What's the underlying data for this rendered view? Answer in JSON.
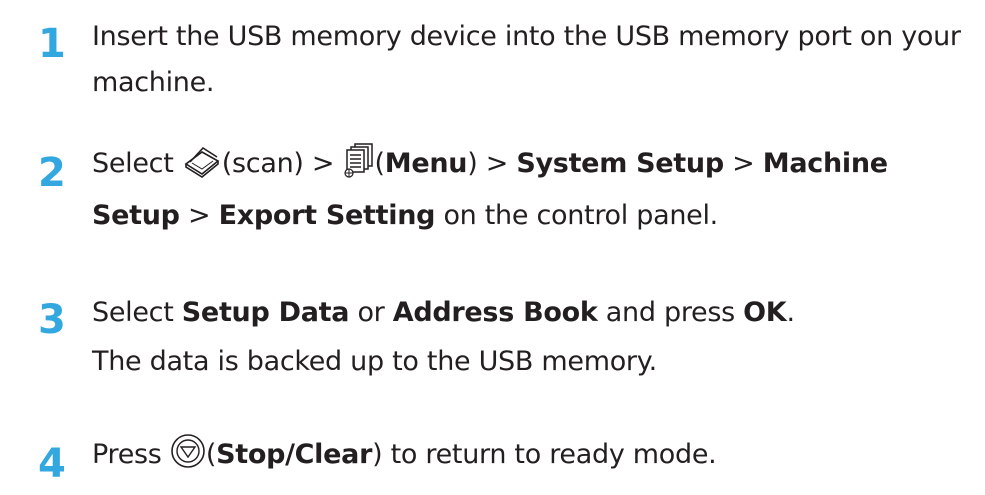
{
  "steps": [
    {
      "number": "1",
      "text": "Insert the USB memory device into the USB memory port on your machine."
    },
    {
      "number": "2",
      "select": "Select",
      "scan_text": "(scan) >",
      "menu_text_open": "(",
      "menu_label": "Menu",
      "menu_text_close": ") >",
      "system_setup": "System Setup",
      "sep1": " >",
      "machine_setup": "Machine Setup",
      "sep2": " >",
      "export_setting": "Export Setting",
      "suffix": " on the control panel.",
      "icons": [
        "scan-icon",
        "menu-icon"
      ]
    },
    {
      "number": "3",
      "select": "Select ",
      "setup_data": "Setup Data",
      "or": " or ",
      "address_book": "Address Book",
      "and_press": " and press ",
      "ok": "OK",
      "period": ".",
      "result": "The data is backed up to the USB memory."
    },
    {
      "number": "4",
      "press": "Press ",
      "open": "(",
      "stop_clear": "Stop/Clear",
      "close": ")",
      "suffix": " to return to ready mode.",
      "icons": [
        "stop-clear-icon"
      ]
    }
  ],
  "colors": {
    "step_number": "#33a7e0",
    "text": "#231f20"
  }
}
